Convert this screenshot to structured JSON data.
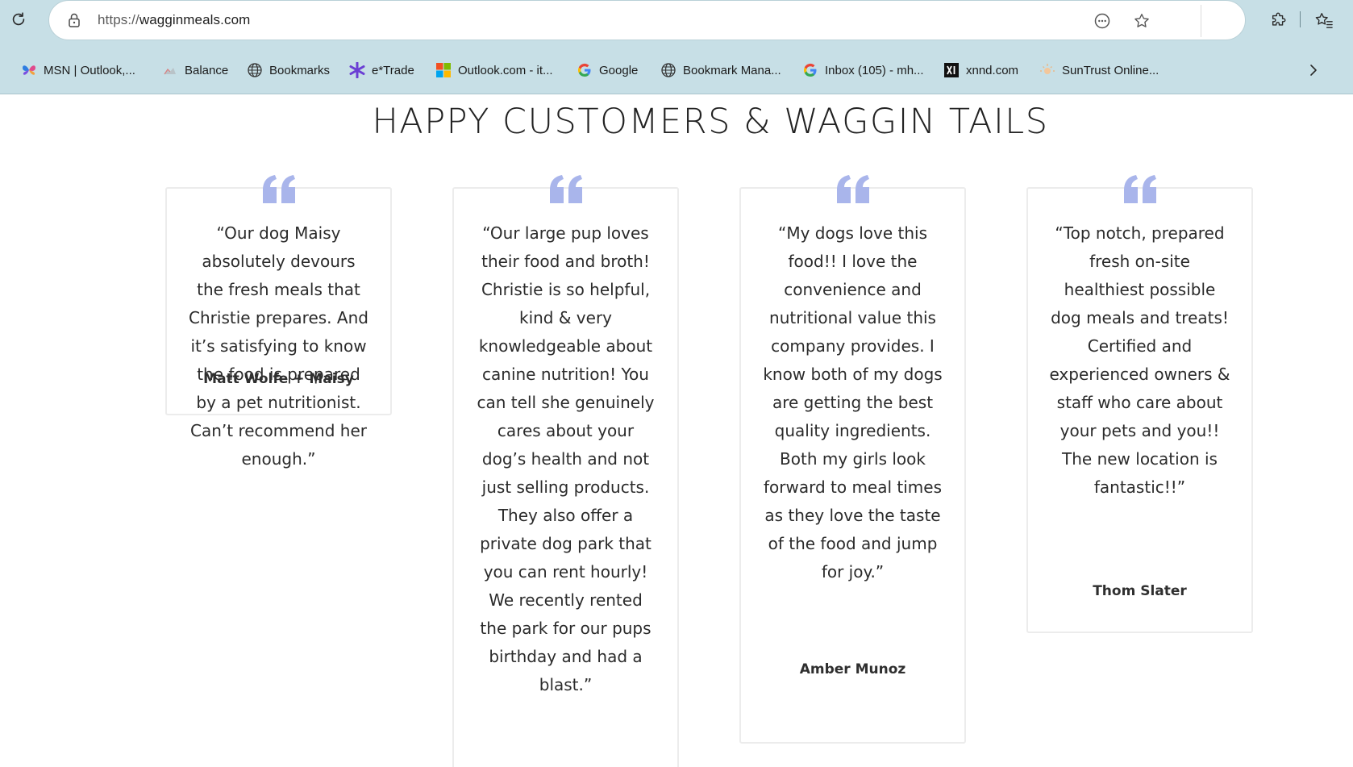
{
  "browser": {
    "url_scheme": "https://",
    "url_host": "wagginmeals.com",
    "bookmarks": [
      {
        "label": "MSN | Outlook,...",
        "icon": "msn-butterfly-icon"
      },
      {
        "label": "Balance",
        "icon": "balance-icon"
      },
      {
        "label": "Bookmarks",
        "icon": "globe-icon"
      },
      {
        "label": "e*Trade",
        "icon": "etrade-icon"
      },
      {
        "label": "Outlook.com - it...",
        "icon": "microsoft-logo-icon"
      },
      {
        "label": "Google",
        "icon": "google-g-icon"
      },
      {
        "label": "Bookmark Mana...",
        "icon": "globe-icon"
      },
      {
        "label": "Inbox (105) - mh...",
        "icon": "google-g-icon"
      },
      {
        "label": "xnnd.com",
        "icon": "xnnd-icon"
      },
      {
        "label": "SunTrust Online...",
        "icon": "suntrust-icon"
      }
    ]
  },
  "page": {
    "heading": "HAPPY CUSTOMERS & WAGGIN TAILS",
    "accent_color": "#a9b5eb",
    "testimonials": [
      {
        "text": "“Our dog Maisy absolutely devours the fresh meals that Christie prepares. And it’s satisfying to know the food is prepared by a pet nutritionist. Can’t recommend her enough.”",
        "name": "Matt Wolfe + Maisy"
      },
      {
        "text": "“Our large pup loves their food and broth! Christie is so helpful, kind & very knowledgeable about canine nutrition! You can tell she genuinely cares about your dog’s health and not just selling products. They also offer a private dog park that you can rent hourly! We recently rented the park for our pups birthday and had a blast.”",
        "name": ""
      },
      {
        "text": "“My dogs love this food!! I love the convenience and nutritional value this company provides. I know both of my dogs are getting the best quality ingredients. Both my girls look forward to meal times as they love the taste of the food and jump for joy.”",
        "name": "Amber Munoz"
      },
      {
        "text": "“Top notch, prepared fresh on-site healthiest possible dog meals and treats! Certified and experienced owners & staff who care about your pets and you!! The new location is fantastic!!”",
        "name": "Thom Slater"
      }
    ]
  }
}
